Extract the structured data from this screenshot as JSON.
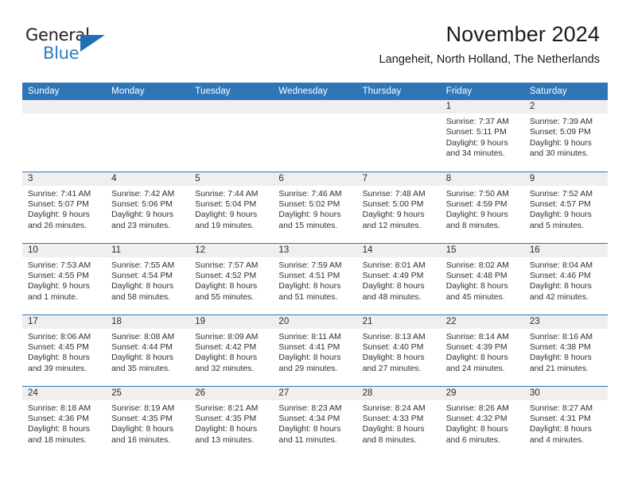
{
  "brand": {
    "line1": "General",
    "line2": "Blue",
    "logo_icon": "triangle-logo-icon",
    "accent_color": "#2e7cc4"
  },
  "header": {
    "title": "November 2024",
    "location": "Langeheit, North Holland, The Netherlands"
  },
  "theme": {
    "header_blue": "#2f76b6",
    "daynum_band": "#efefef",
    "text": "#303030"
  },
  "weekdays": [
    "Sunday",
    "Monday",
    "Tuesday",
    "Wednesday",
    "Thursday",
    "Friday",
    "Saturday"
  ],
  "labels": {
    "sunrise": "Sunrise:",
    "sunset": "Sunset:",
    "daylight": "Daylight:"
  },
  "weeks": [
    [
      {
        "day": "",
        "blank": true
      },
      {
        "day": "",
        "blank": true
      },
      {
        "day": "",
        "blank": true
      },
      {
        "day": "",
        "blank": true
      },
      {
        "day": "",
        "blank": true
      },
      {
        "day": "1",
        "sunrise": "Sunrise: 7:37 AM",
        "sunset": "Sunset: 5:11 PM",
        "daylight1": "Daylight: 9 hours",
        "daylight2": "and 34 minutes."
      },
      {
        "day": "2",
        "sunrise": "Sunrise: 7:39 AM",
        "sunset": "Sunset: 5:09 PM",
        "daylight1": "Daylight: 9 hours",
        "daylight2": "and 30 minutes."
      }
    ],
    [
      {
        "day": "3",
        "sunrise": "Sunrise: 7:41 AM",
        "sunset": "Sunset: 5:07 PM",
        "daylight1": "Daylight: 9 hours",
        "daylight2": "and 26 minutes."
      },
      {
        "day": "4",
        "sunrise": "Sunrise: 7:42 AM",
        "sunset": "Sunset: 5:06 PM",
        "daylight1": "Daylight: 9 hours",
        "daylight2": "and 23 minutes."
      },
      {
        "day": "5",
        "sunrise": "Sunrise: 7:44 AM",
        "sunset": "Sunset: 5:04 PM",
        "daylight1": "Daylight: 9 hours",
        "daylight2": "and 19 minutes."
      },
      {
        "day": "6",
        "sunrise": "Sunrise: 7:46 AM",
        "sunset": "Sunset: 5:02 PM",
        "daylight1": "Daylight: 9 hours",
        "daylight2": "and 15 minutes."
      },
      {
        "day": "7",
        "sunrise": "Sunrise: 7:48 AM",
        "sunset": "Sunset: 5:00 PM",
        "daylight1": "Daylight: 9 hours",
        "daylight2": "and 12 minutes."
      },
      {
        "day": "8",
        "sunrise": "Sunrise: 7:50 AM",
        "sunset": "Sunset: 4:59 PM",
        "daylight1": "Daylight: 9 hours",
        "daylight2": "and 8 minutes."
      },
      {
        "day": "9",
        "sunrise": "Sunrise: 7:52 AM",
        "sunset": "Sunset: 4:57 PM",
        "daylight1": "Daylight: 9 hours",
        "daylight2": "and 5 minutes."
      }
    ],
    [
      {
        "day": "10",
        "sunrise": "Sunrise: 7:53 AM",
        "sunset": "Sunset: 4:55 PM",
        "daylight1": "Daylight: 9 hours",
        "daylight2": "and 1 minute."
      },
      {
        "day": "11",
        "sunrise": "Sunrise: 7:55 AM",
        "sunset": "Sunset: 4:54 PM",
        "daylight1": "Daylight: 8 hours",
        "daylight2": "and 58 minutes."
      },
      {
        "day": "12",
        "sunrise": "Sunrise: 7:57 AM",
        "sunset": "Sunset: 4:52 PM",
        "daylight1": "Daylight: 8 hours",
        "daylight2": "and 55 minutes."
      },
      {
        "day": "13",
        "sunrise": "Sunrise: 7:59 AM",
        "sunset": "Sunset: 4:51 PM",
        "daylight1": "Daylight: 8 hours",
        "daylight2": "and 51 minutes."
      },
      {
        "day": "14",
        "sunrise": "Sunrise: 8:01 AM",
        "sunset": "Sunset: 4:49 PM",
        "daylight1": "Daylight: 8 hours",
        "daylight2": "and 48 minutes."
      },
      {
        "day": "15",
        "sunrise": "Sunrise: 8:02 AM",
        "sunset": "Sunset: 4:48 PM",
        "daylight1": "Daylight: 8 hours",
        "daylight2": "and 45 minutes."
      },
      {
        "day": "16",
        "sunrise": "Sunrise: 8:04 AM",
        "sunset": "Sunset: 4:46 PM",
        "daylight1": "Daylight: 8 hours",
        "daylight2": "and 42 minutes."
      }
    ],
    [
      {
        "day": "17",
        "sunrise": "Sunrise: 8:06 AM",
        "sunset": "Sunset: 4:45 PM",
        "daylight1": "Daylight: 8 hours",
        "daylight2": "and 39 minutes."
      },
      {
        "day": "18",
        "sunrise": "Sunrise: 8:08 AM",
        "sunset": "Sunset: 4:44 PM",
        "daylight1": "Daylight: 8 hours",
        "daylight2": "and 35 minutes."
      },
      {
        "day": "19",
        "sunrise": "Sunrise: 8:09 AM",
        "sunset": "Sunset: 4:42 PM",
        "daylight1": "Daylight: 8 hours",
        "daylight2": "and 32 minutes."
      },
      {
        "day": "20",
        "sunrise": "Sunrise: 8:11 AM",
        "sunset": "Sunset: 4:41 PM",
        "daylight1": "Daylight: 8 hours",
        "daylight2": "and 29 minutes."
      },
      {
        "day": "21",
        "sunrise": "Sunrise: 8:13 AM",
        "sunset": "Sunset: 4:40 PM",
        "daylight1": "Daylight: 8 hours",
        "daylight2": "and 27 minutes."
      },
      {
        "day": "22",
        "sunrise": "Sunrise: 8:14 AM",
        "sunset": "Sunset: 4:39 PM",
        "daylight1": "Daylight: 8 hours",
        "daylight2": "and 24 minutes."
      },
      {
        "day": "23",
        "sunrise": "Sunrise: 8:16 AM",
        "sunset": "Sunset: 4:38 PM",
        "daylight1": "Daylight: 8 hours",
        "daylight2": "and 21 minutes."
      }
    ],
    [
      {
        "day": "24",
        "sunrise": "Sunrise: 8:18 AM",
        "sunset": "Sunset: 4:36 PM",
        "daylight1": "Daylight: 8 hours",
        "daylight2": "and 18 minutes."
      },
      {
        "day": "25",
        "sunrise": "Sunrise: 8:19 AM",
        "sunset": "Sunset: 4:35 PM",
        "daylight1": "Daylight: 8 hours",
        "daylight2": "and 16 minutes."
      },
      {
        "day": "26",
        "sunrise": "Sunrise: 8:21 AM",
        "sunset": "Sunset: 4:35 PM",
        "daylight1": "Daylight: 8 hours",
        "daylight2": "and 13 minutes."
      },
      {
        "day": "27",
        "sunrise": "Sunrise: 8:23 AM",
        "sunset": "Sunset: 4:34 PM",
        "daylight1": "Daylight: 8 hours",
        "daylight2": "and 11 minutes."
      },
      {
        "day": "28",
        "sunrise": "Sunrise: 8:24 AM",
        "sunset": "Sunset: 4:33 PM",
        "daylight1": "Daylight: 8 hours",
        "daylight2": "and 8 minutes."
      },
      {
        "day": "29",
        "sunrise": "Sunrise: 8:26 AM",
        "sunset": "Sunset: 4:32 PM",
        "daylight1": "Daylight: 8 hours",
        "daylight2": "and 6 minutes."
      },
      {
        "day": "30",
        "sunrise": "Sunrise: 8:27 AM",
        "sunset": "Sunset: 4:31 PM",
        "daylight1": "Daylight: 8 hours",
        "daylight2": "and 4 minutes."
      }
    ]
  ]
}
